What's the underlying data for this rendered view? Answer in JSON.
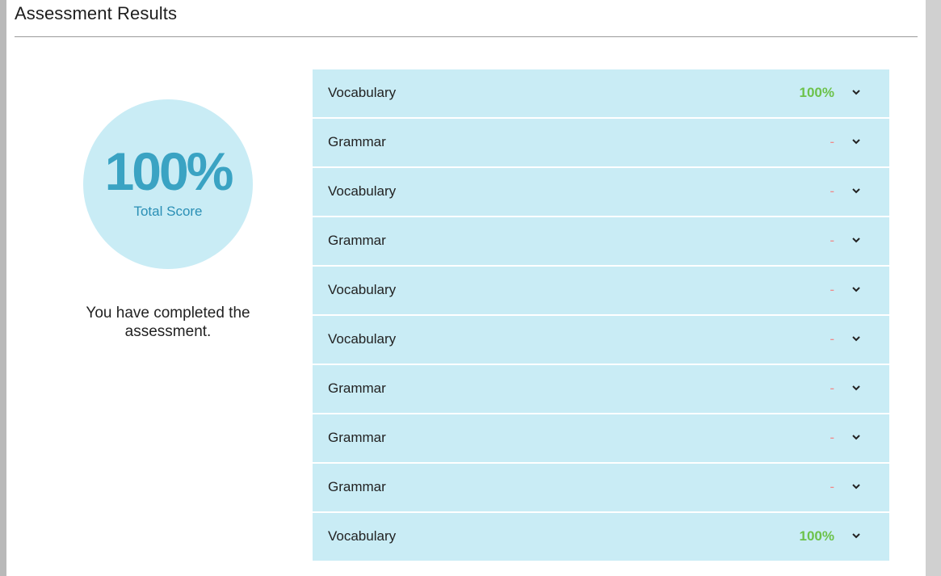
{
  "header": {
    "title": "Assessment Results"
  },
  "summary": {
    "score": "100%",
    "score_label": "Total Score",
    "completion_message": "You have completed the assessment."
  },
  "colors": {
    "pass": "#6cc24a",
    "none": "#f08a8a",
    "row_bg": "#c9ecf5",
    "score": "#3aa3c3"
  },
  "results": [
    {
      "name": "Vocabulary",
      "score": "100%",
      "status": "pass"
    },
    {
      "name": "Grammar",
      "score": "-",
      "status": "none"
    },
    {
      "name": "Vocabulary",
      "score": "-",
      "status": "none"
    },
    {
      "name": "Grammar",
      "score": "-",
      "status": "none"
    },
    {
      "name": "Vocabulary",
      "score": "-",
      "status": "none"
    },
    {
      "name": "Vocabulary",
      "score": "-",
      "status": "none"
    },
    {
      "name": "Grammar",
      "score": "-",
      "status": "none"
    },
    {
      "name": "Grammar",
      "score": "-",
      "status": "none"
    },
    {
      "name": "Grammar",
      "score": "-",
      "status": "none"
    },
    {
      "name": "Vocabulary",
      "score": "100%",
      "status": "pass"
    }
  ]
}
